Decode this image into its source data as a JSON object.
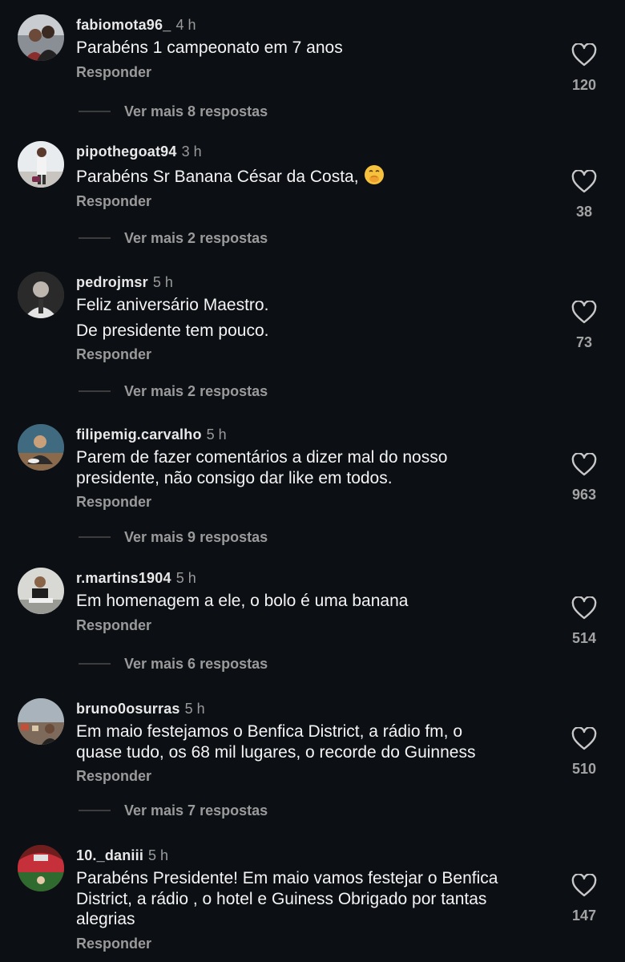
{
  "colors": {
    "background": "#0c0f14",
    "text": "#f4f4f4",
    "muted": "#9a9a9a"
  },
  "comments": [
    {
      "username": "fabiomota96_",
      "time": "4 h",
      "lines": [
        "Parabéns 1 campeonato em 7 anos"
      ],
      "reply": "Responder",
      "likes": "120",
      "more": "Ver mais 8 respostas"
    },
    {
      "username": "pipothegoat94",
      "time": "3 h",
      "lines": [
        "Parabéns Sr Banana César da Costa,"
      ],
      "emoji": "hand-over-mouth-emoji",
      "reply": "Responder",
      "likes": "38",
      "more": "Ver mais 2 respostas"
    },
    {
      "username": "pedrojmsr",
      "time": "5 h",
      "lines": [
        "Feliz aniversário Maestro.",
        "De presidente tem pouco."
      ],
      "reply": "Responder",
      "likes": "73",
      "more": "Ver mais 2 respostas"
    },
    {
      "username": "filipemig.carvalho",
      "time": "5 h",
      "lines": [
        "Parem de fazer comentários a dizer mal do nosso",
        "presidente, não consigo dar like em todos."
      ],
      "reply": "Responder",
      "likes": "963",
      "more": "Ver mais 9 respostas"
    },
    {
      "username": "r.martins1904",
      "time": "5 h",
      "lines": [
        "Em homenagem a ele, o bolo é uma banana"
      ],
      "reply": "Responder",
      "likes": "514",
      "more": "Ver mais 6 respostas"
    },
    {
      "username": "bruno0osurras",
      "time": "5 h",
      "lines": [
        "Em maio festejamos o Benfica District, a rádio fm, o",
        "quase tudo, os 68 mil lugares, o recorde do Guinness"
      ],
      "reply": "Responder",
      "likes": "510",
      "more": "Ver mais 7 respostas"
    },
    {
      "username": "10._daniii",
      "time": "5 h",
      "lines": [
        "Parabéns Presidente! Em maio vamos festejar o Benfica",
        "District, a rádio , o hotel e Guiness  Obrigado por tantas",
        "alegrias"
      ],
      "reply": "Responder",
      "likes": "147"
    }
  ]
}
